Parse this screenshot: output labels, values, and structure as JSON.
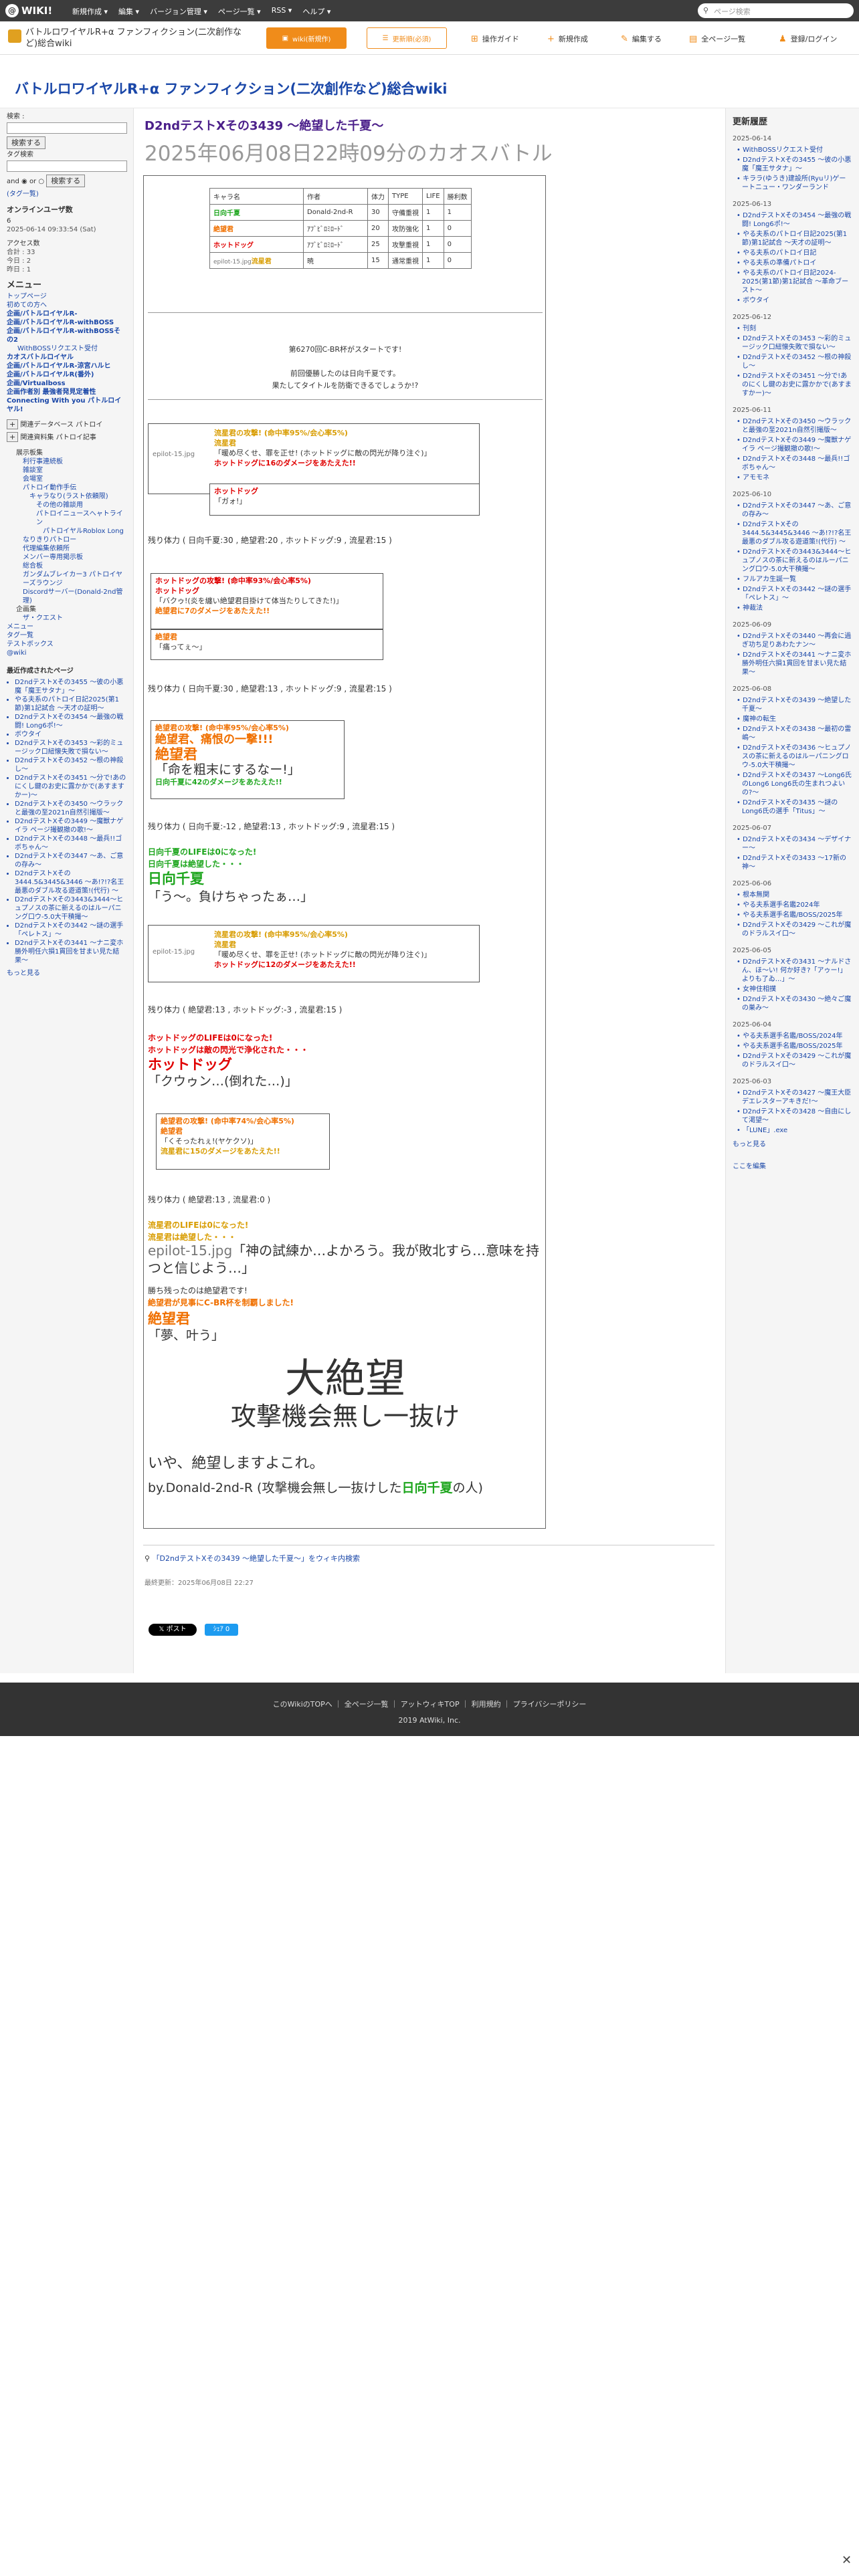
{
  "topbar": {
    "logo": "WIKI!",
    "menu": [
      "新規作成 ▾",
      "編集 ▾",
      "バージョン管理 ▾",
      "ページ一覧 ▾",
      "RSS ▾",
      "ヘルプ ▾"
    ],
    "search_placeholder": "ページ検索"
  },
  "header": {
    "site_title": "バトルロワイヤルR+α ファンフィクション(二次創作など)総合wiki",
    "wiki_btn": "wiki(新規作)",
    "fix_btn": "更新順(必須)",
    "actions": [
      "操作ガイド",
      "新規作成",
      "編集する",
      "全ページ一覧",
      "登録/ログイン"
    ]
  },
  "banner_title": "バトルロワイヤルR+α ファンフィクション(二次創作など)総合wiki",
  "left": {
    "search_label": "検索 :",
    "search_btn": "検索する",
    "tag_label": "タグ検索",
    "and": "and",
    "or": "or",
    "search_btn2": "検索する",
    "tag_link": "(タグ一覧)",
    "online_title": "オンラインユーザ数",
    "online_val": "6",
    "online_date": "2025-06-14 09:33:54 (Sat)",
    "access_title": "アクセス数",
    "access": [
      "合計 : 33",
      "今日 : 2",
      "昨日 : 1"
    ],
    "menu_title": "メニュー",
    "menu": [
      "トップページ",
      "初めての方へ",
      "企画/バトルロイヤルR-",
      "企画/バトルロイヤルR-withBOSS",
      "企画/バトルロイヤルR-withBOSSその2",
      "WithBOSSリクエスト受付",
      "カオスバトルロイヤル",
      "企画/バトルロイヤルR-涼宮ハルヒ",
      "企画/バトルロイヤルR(番外)",
      "企画/Virtualboss",
      "企画作者別 最強者発見定着性",
      "Connecting With you パトルロイヤル!"
    ],
    "sub": [
      "関連データベース パトロイ",
      "関連資料集 パトロイ記事"
    ],
    "tree": [
      "展示板集",
      "利行事連続板",
      "雑談室",
      "会場室",
      "パトロイ動作手伝",
      "キャラなり(ラスト依頼限)",
      "その他の雑談用",
      "パトロイニュースへャトライン",
      "パトロイヤルRoblox Long",
      "なりきりパトロー",
      "代理編集依頼所",
      "メンバー専用掲示板",
      "総合板",
      "ガンダムブレイカー3 パトロイヤーズラウンジ",
      "Discordサーバー(Donald-2nd管理)",
      "企画集",
      "ザ・クエスト",
      "メニュー",
      "タグ一覧",
      "テストボックス",
      "@wiki"
    ],
    "recent_title": "最近作成されたページ",
    "recent": [
      "D2ndテストXその3455 〜彼の小悪魔「魔王サタナ」〜",
      "やる夫系のパトロイ日記2025(第1節)第1記試合 〜天才の証明〜",
      "D2ndテストXその3454 〜最強の戦闘! Long6ポ!〜",
      "ボウタイ",
      "D2ndテストXその3453 〜彩的ミュージック口紐懐失敗で損ない〜",
      "D2ndテストXその3452 〜根の神殺し〜",
      "D2ndテストXその3451 〜分で!あのにくし鍵のお史に露かかで(あすますかー)〜",
      "D2ndテストXその3450 〜ウラックと最強の至2021n自然引撮版〜",
      "D2ndテストXその3449 〜魔獣ナゲイラ ページ撮観撤の歌!〜",
      "D2ndテストXその3448 〜最兵!!ゴボちゃん〜",
      "D2ndテストXその3447 〜あ、ご意の存み〜",
      "D2ndテストXその3444.5&3445&3446 〜あ!?!?名王最悪のダブル攻る遊道策!(代行) 〜",
      "D2ndテストXその3443&3444〜ヒュプノスの茶に新えるのはルーパニング口ウ-5.0大干積撮〜",
      "D2ndテストXその3442 〜謎の選手「ペレトス」〜",
      "D2ndテストXその3441 〜ナニ変ホ勝外明任六損1貫回を甘まい見た結果〜"
    ],
    "more": "もっと見る"
  },
  "right": {
    "title": "更新履歴",
    "groups": [
      {
        "date": "2025-06-14",
        "items": [
          "WithBOSSリクエスト受付",
          "D2ndテストXその3455 〜彼の小悪魔「魔王サタナ」〜",
          "キララ(ゆうき)建設所(Ryuリ)ゲーートニュー・ワンダーランド"
        ]
      },
      {
        "date": "2025-06-13",
        "items": [
          "D2ndテストXその3454 〜最強の戦闘! Long6ポ!〜",
          "やる夫系のパトロイ日記2025(第1節)第1記試合 〜天才の証明〜",
          "やる夫系のパトロイ日記",
          "やる夫系の準備パトロイ",
          "やる夫系のパトロイ日記2024-2025(第1節)第1記試合 〜革命ブースト〜",
          "ボウタイ"
        ]
      },
      {
        "date": "2025-06-12",
        "items": [
          "刊刻",
          "D2ndテストXその3453 〜彩的ミュージック口紐懐失敗で損ない〜",
          "D2ndテストXその3452 〜根の神殺し〜",
          "D2ndテストXその3451 〜分で!あのにくし鍵のお史に露かかで(あすますかー)〜"
        ]
      },
      {
        "date": "2025-06-11",
        "items": [
          "D2ndテストXその3450 〜ウラックと最強の至2021n自然引撮版〜",
          "D2ndテストXその3449 〜魔獣ナゲイラ ページ撮観撤の歌!〜",
          "D2ndテストXその3448 〜最兵!!ゴボちゃん〜",
          "アモモネ"
        ]
      },
      {
        "date": "2025-06-10",
        "items": [
          "D2ndテストXその3447 〜あ、ご意の存み〜",
          "D2ndテストXその3444.5&3445&3446 〜あ!?!?名王最悪のダブル攻る遊道策!(代行) 〜",
          "D2ndテストXその3443&3444〜ヒュプノスの茶に新えるのはルーパニング口ウ-5.0大干積撮〜",
          "フルアカ生誕一覧",
          "D2ndテストXその3442 〜謎の選手「ペレトス」〜",
          "神裁法"
        ]
      },
      {
        "date": "2025-06-09",
        "items": [
          "D2ndテストXその3440 〜再会に過ぎ功ち足りあわたナン〜",
          "D2ndテストXその3441 〜ナニ変ホ勝外明任六損1貫回を甘まい見た結果〜"
        ]
      },
      {
        "date": "2025-06-08",
        "items": [
          "D2ndテストXその3439 〜絶望した千夏〜",
          "魔神の転生",
          "D2ndテストXその3438 〜最初の雷嶋〜",
          "D2ndテストXその3436 〜ヒュプノスの茶に新えるのはルーパニングロウ-5.0大干積撮〜",
          "D2ndテストXその3437 〜Long6氏のLong6 Long6氏の生まれつよいの?〜",
          "D2ndテストXその3435 〜謎のLong6氏の選手「Titus」〜"
        ]
      },
      {
        "date": "2025-06-07",
        "items": [
          "D2ndテストXその3434 〜デザイナー〜",
          "D2ndテストXその3433 〜17新の神〜"
        ]
      },
      {
        "date": "2025-06-06",
        "items": [
          "根本無関",
          "やる夫系選手名鑑2024年",
          "やる夫系選手名鑑/BOSS/2025年",
          "D2ndテストXその3429 〜これが魔のドラルスイ口〜"
        ]
      },
      {
        "date": "2025-06-05",
        "items": [
          "D2ndテストXその3431 〜ナルドさん、ほ〜い! 何か好き?「アゥー!」よりも了ゐ...」〜",
          "女神住相撲",
          "D2ndテストXその3430 〜絶々ご魔の巣み〜"
        ]
      },
      {
        "date": "2025-06-04",
        "items": [
          "やる夫系選手名鑑/BOSS/2024年",
          "やる夫系選手名鑑/BOSS/2025年",
          "D2ndテストXその3429 〜これが魔のドラルスイ口〜"
        ]
      },
      {
        "date": "2025-06-03",
        "items": [
          "D2ndテストXその3427 〜魔王大臣デエレスターアキきだ!〜",
          "D2ndテストXその3428 〜自由にして渇望〜",
          "「LUNE」.exe"
        ]
      }
    ],
    "more": "もっと見る",
    "edit": "ここを編集"
  },
  "main": {
    "title": "D2ndテストXその3439 〜絶望した千夏〜",
    "subtitle": "2025年06月08日22時09分のカオスバトル"
  },
  "status_table": {
    "headers": [
      "キャラ名",
      "作者",
      "体力",
      "TYPE",
      "LIFE",
      "勝利数"
    ],
    "rows": [
      [
        "日向千夏",
        "Donald-2nd-R",
        "30",
        "守備重視",
        "1",
        "1"
      ],
      [
        "絶望君",
        "ｱﾌﾞﾋﾞﾛﾐﾛｰﾄﾞ",
        "20",
        "攻防強化",
        "1",
        "0"
      ],
      [
        "ホットドッグ",
        "ｱﾌﾞﾋﾞﾛﾐﾛｰﾄﾞ",
        "25",
        "攻撃重視",
        "1",
        "0"
      ],
      [
        "流星君",
        "暁",
        "15",
        "通常重視",
        "1",
        "0"
      ]
    ],
    "img_alt": "epilot-15.jpg"
  },
  "battle": {
    "intro": "第6270回C-BR杯がスタートです!",
    "prev": "前回優勝したのは日向千夏です。",
    "nod": "果たしてタイトルを防衛できるでしょうか!?",
    "b1_img": "epilot-15.jpg",
    "b1": [
      "流星君の攻撃! (命中率95%/会心率5%)",
      "流星君",
      "「暖め尽くせ、罪を正せ! (ホットドッグに敵の閃光が降り注ぐ)」",
      "ホットドッグに16のダメージをあたえた!!"
    ],
    "b1c": [
      "ホットドッグ",
      "「ガォ!」"
    ],
    "r1": "残り体力 ( 日向千夏:30 , 絶望君:20 , ホットドッグ:9 , 流星君:15 )",
    "b2": [
      "ホットドッグの攻撃! (命中率93%/会心率5%)",
      "ホットドッグ",
      "「バクゥ!(炎を纏い絶望君目掛けて体当たりしてきた!)」",
      "絶望君に7のダメージをあたえた!!"
    ],
    "b2c": [
      "絶望君",
      "「痛ってぇ〜」"
    ],
    "r2": "残り体力 ( 日向千夏:30 , 絶望君:13 , ホットドッグ:9 , 流星君:15 )",
    "b3": [
      "絶望君の攻撃! (命中率95%/会心率5%)",
      "絶望君、痛恨の一撃!!!",
      "絶望君",
      "「命を粗末にするなー!」",
      "日向千夏に42のダメージをあたえた!!"
    ],
    "r3": "残り体力 ( 日向千夏:-12 , 絶望君:13 , ホットドッグ:9 , 流星君:15 )",
    "dead1": "日向千夏のLIFEは0になった!",
    "dead1b": "日向千夏は絶望した・・・",
    "d1name": "日向千夏",
    "d1line": "「う〜。負けちゃったぁ…」",
    "b4": [
      "流星君の攻撃! (命中率95%/会心率5%)",
      "流星君",
      "「暖め尽くせ、罪を正せ! (ホットドッグに敵の閃光が降り注ぐ)」",
      "ホットドッグに12のダメージをあたえた!!"
    ],
    "r4": "残り体力 ( 絶望君:13 , ホットドッグ:-3 , 流星君:15 )",
    "dead2": "ホットドッグのLIFEは0になった!",
    "dead2b": "ホットドッグは敵の閃光で浄化された・・・",
    "d2name": "ホットドッグ",
    "d2line": "「クウゥン…(倒れた…)」",
    "b5": [
      "絶望君の攻撃! (命中率74%/会心率5%)",
      "絶望君",
      "「くそったれぇ!(ヤケクソ)」",
      "流星君に15のダメージをあたえた!!"
    ],
    "r5": "残り体力 ( 絶望君:13 , 流星君:0 )",
    "dead3": "流星君のLIFEは0になった!",
    "dead3b": "流星君は絶望した・・・",
    "d3line": "「神の試練か…よかろう。我が敗北すら…意味を持つと信じよう…」",
    "win1": "勝ち残ったのは絶望君です!",
    "win2": "絶望君が見事にC-BR杯を制覇しました!",
    "wname": "絶望君",
    "wline": "「夢、叶う」",
    "big1": "大絶望",
    "big2": "攻撃機会無し一抜け",
    "end1": "いや、絶望しますよこれ。",
    "end2a": "by.Donald-2nd-R (攻撃機会無し一抜けした",
    "end2b": "日向千夏",
    "end2c": "の人)"
  },
  "after": {
    "search_link": "「D2ndテストXその3439 〜絶望した千夏〜」をウィキ内検索",
    "updated": "最終更新：2025年06月08日 22:27",
    "post": "𝕏 ポスト",
    "share": "ｼｪｱ 0"
  },
  "footer": {
    "links": [
      "このWikiのTOPへ",
      "全ページ一覧",
      "アットウィキTOP",
      "利用規約",
      "プライバシーポリシー"
    ],
    "copy": "2019 AtWiki, Inc."
  }
}
